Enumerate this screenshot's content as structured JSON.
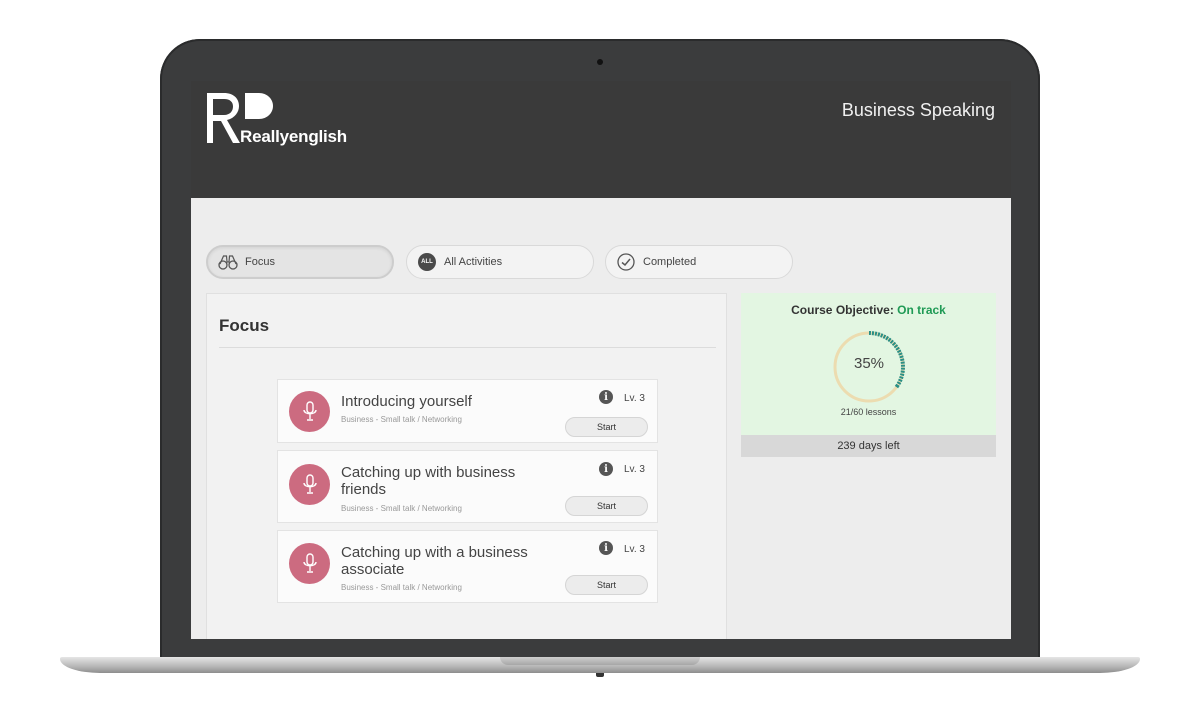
{
  "app": {
    "brand_name": "Reallyenglish",
    "course_title": "Business Speaking"
  },
  "tabs": [
    {
      "label": "Focus",
      "icon": "binoculars-icon",
      "active": true
    },
    {
      "label": "All Activities",
      "icon": "all-badge",
      "badge": "ALL",
      "active": false
    },
    {
      "label": "Completed",
      "icon": "check-circle-icon",
      "active": false
    }
  ],
  "focus": {
    "heading": "Focus",
    "cards": [
      {
        "title": "Introducing yourself",
        "meta": "Business - Small talk / Networking",
        "level": "Lv. 3",
        "start_label": "Start",
        "icon": "microphone-icon"
      },
      {
        "title": "Catching up with business friends",
        "meta": "Business - Small talk / Networking",
        "level": "Lv. 3",
        "start_label": "Start",
        "icon": "microphone-icon"
      },
      {
        "title": "Catching up with a business associate",
        "meta": "Business - Small talk / Networking",
        "level": "Lv. 3",
        "start_label": "Start",
        "icon": "microphone-icon"
      }
    ]
  },
  "objective": {
    "label": "Course Objective: ",
    "status": "On track",
    "progress_percent_label": "35%",
    "progress_fraction": 0.35,
    "lessons_label": "21/60 lessons",
    "days_left": "239 days left"
  },
  "colors": {
    "accent_green": "#1f9a55",
    "ring_track": "#ecdcb0",
    "ring_fill": "#2a8f86",
    "mic_badge": "#cc6b80",
    "header_bg": "#3a3a3a"
  }
}
